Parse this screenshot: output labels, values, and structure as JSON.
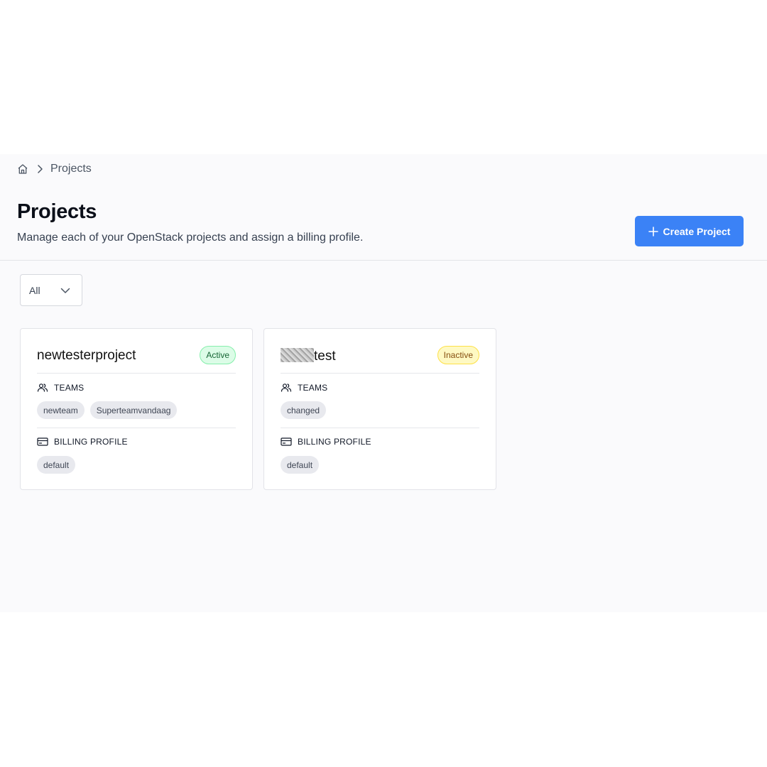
{
  "breadcrumb": {
    "home_icon": "home-icon",
    "separator_icon": "chevron-right-icon",
    "current": "Projects"
  },
  "header": {
    "title": "Projects",
    "subtitle": "Manage each of your OpenStack projects and assign a billing profile.",
    "create_button": {
      "label": "Create Project",
      "icon": "plus-icon",
      "color": "#3b82f6"
    }
  },
  "filter": {
    "selected": "All",
    "icon": "chevron-down-icon"
  },
  "projects": [
    {
      "name": "newtesterproject",
      "status": "Active",
      "teams_heading": "TEAMS",
      "teams": [
        "newteam",
        "Superteamvandaag"
      ],
      "billing_heading": "BILLING PROFILE",
      "billing_profiles": [
        "default"
      ]
    },
    {
      "name": "test",
      "name_prefix_redacted": true,
      "status": "Inactive",
      "teams_heading": "TEAMS",
      "teams": [
        "changed"
      ],
      "billing_heading": "BILLING PROFILE",
      "billing_profiles": [
        "default"
      ]
    }
  ],
  "colors": {
    "active_badge_bg": "#dcfce7",
    "active_badge_text": "#166534",
    "inactive_badge_bg": "#fef9c3",
    "inactive_badge_text": "#854d0e"
  }
}
